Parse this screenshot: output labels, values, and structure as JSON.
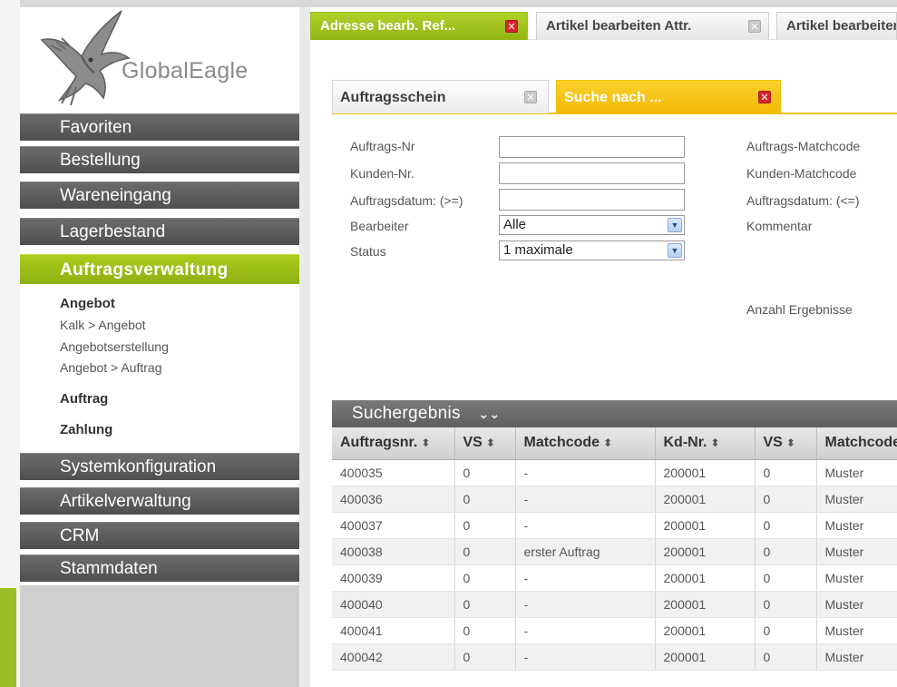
{
  "logo": {
    "text": "GlobalEagle"
  },
  "sidebar": {
    "nav": [
      {
        "label": "Favoriten"
      },
      {
        "label": "Bestellung"
      },
      {
        "label": "Wareneingang"
      },
      {
        "label": "Lagerbestand"
      },
      {
        "label": "Auftragsverwaltung",
        "active": true
      },
      {
        "label": "Systemkonfiguration"
      },
      {
        "label": "Artikelverwaltung"
      },
      {
        "label": "CRM"
      },
      {
        "label": "Stammdaten"
      }
    ],
    "sub": [
      {
        "label": "Angebot",
        "head": true
      },
      {
        "label": "Kalk > Angebot"
      },
      {
        "label": "Angebotserstellung"
      },
      {
        "label": "Angebot > Auftrag"
      },
      {
        "label": "Auftrag",
        "head": true
      },
      {
        "label": "Zahlung",
        "head": true
      }
    ]
  },
  "outer_tabs": [
    {
      "label": "Adresse bearb. Ref...",
      "active": true
    },
    {
      "label": "Artikel bearbeiten Attr."
    },
    {
      "label": "Artikel bearbeiten"
    }
  ],
  "inner_tabs": [
    {
      "label": "Auftragsschein"
    },
    {
      "label": "Suche nach ...",
      "active": true
    }
  ],
  "form": {
    "auftrags_nr": {
      "label": "Auftrags-Nr",
      "value": ""
    },
    "kunden_nr": {
      "label": "Kunden-Nr.",
      "value": ""
    },
    "auftragsdatum_from": {
      "label": "Auftragsdatum: (>=)",
      "value": ""
    },
    "bearbeiter": {
      "label": "Bearbeiter",
      "value": "Alle"
    },
    "status": {
      "label": "Status",
      "value": "1 maximale"
    },
    "auftrags_matchcode": {
      "label": "Auftrags-Matchcode"
    },
    "kunden_matchcode": {
      "label": "Kunden-Matchcode"
    },
    "auftragsdatum_to": {
      "label": "Auftragsdatum: (<=)"
    },
    "kommentar": {
      "label": "Kommentar"
    },
    "anzahl": {
      "label": "Anzahl Ergebnisse"
    }
  },
  "results": {
    "title": "Suchergebnis",
    "columns": [
      "Auftragsnr.",
      "VS",
      "Matchcode",
      "Kd-Nr.",
      "VS",
      "Matchcode"
    ],
    "rows": [
      [
        "400035",
        "0",
        "-",
        "200001",
        "0",
        "Muster"
      ],
      [
        "400036",
        "0",
        "-",
        "200001",
        "0",
        "Muster"
      ],
      [
        "400037",
        "0",
        "-",
        "200001",
        "0",
        "Muster"
      ],
      [
        "400038",
        "0",
        "erster Auftrag",
        "200001",
        "0",
        "Muster"
      ],
      [
        "400039",
        "0",
        "-",
        "200001",
        "0",
        "Muster"
      ],
      [
        "400040",
        "0",
        "-",
        "200001",
        "0",
        "Muster"
      ],
      [
        "400041",
        "0",
        "-",
        "200001",
        "0",
        "Muster"
      ],
      [
        "400042",
        "0",
        "-",
        "200001",
        "0",
        "Muster"
      ]
    ]
  },
  "colors": {
    "accent_green": "#9cbd24",
    "accent_yellow": "#f2b807",
    "nav_grey": "#5a5a5a"
  }
}
